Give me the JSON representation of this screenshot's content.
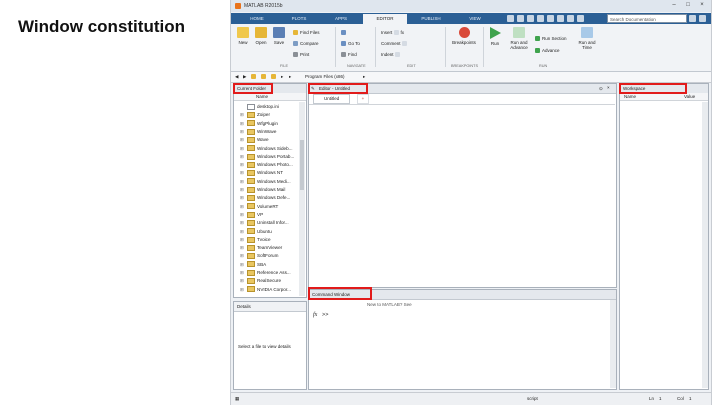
{
  "slide": {
    "title": "Window constitution"
  },
  "window": {
    "title": "MATLAB R2015b"
  },
  "toolstrip": {
    "tabs": [
      "HOME",
      "PLOTS",
      "APPS",
      "EDITOR",
      "PUBLISH",
      "VIEW"
    ],
    "active_tab": "EDITOR",
    "search_placeholder": "Search Documentation"
  },
  "ribbon": {
    "file": {
      "new": "New",
      "open": "Open",
      "save": "Save",
      "find_files": "Find Files",
      "compare": "Compare",
      "print": "Print",
      "group": "FILE"
    },
    "navigate": {
      "go_to": "Go To",
      "find": "Find",
      "group": "NAVIGATE"
    },
    "edit": {
      "insert": "Insert",
      "comment": "Comment",
      "indent": "Indent",
      "fx": "fx",
      "group": "EDIT"
    },
    "breakpoints": {
      "label": "Breakpoints",
      "group": "BREAKPOINTS"
    },
    "run": {
      "run": "Run",
      "run_and_advance": "Run and Advance",
      "run_section": "Run Section",
      "advance": "Advance",
      "run_and_time": "Run and Time",
      "group": "RUN"
    }
  },
  "address": {
    "path": "Program Files (x86)"
  },
  "current_folder": {
    "title": "Current Folder",
    "column": "Name",
    "files": [
      {
        "plus": "",
        "name": "desktop.ini",
        "folder": false
      },
      {
        "plus": "⊞",
        "name": "Zoiper",
        "folder": true
      },
      {
        "plus": "⊞",
        "name": "WfgPlugin",
        "folder": true
      },
      {
        "plus": "⊞",
        "name": "WinWave",
        "folder": true
      },
      {
        "plus": "⊞",
        "name": "Wave",
        "folder": true
      },
      {
        "plus": "⊞",
        "name": "Windows Sideb...",
        "folder": true
      },
      {
        "plus": "⊞",
        "name": "Windows Portab...",
        "folder": true
      },
      {
        "plus": "⊞",
        "name": "Windows Photo...",
        "folder": true
      },
      {
        "plus": "⊞",
        "name": "Windows NT",
        "folder": true
      },
      {
        "plus": "⊞",
        "name": "Windows Medi...",
        "folder": true
      },
      {
        "plus": "⊞",
        "name": "Windows Mail",
        "folder": true
      },
      {
        "plus": "⊞",
        "name": "Windows Defe...",
        "folder": true
      },
      {
        "plus": "⊞",
        "name": "VolumeRT",
        "folder": true
      },
      {
        "plus": "⊞",
        "name": "VP",
        "folder": true
      },
      {
        "plus": "⊞",
        "name": "Uninstall Infor...",
        "folder": true
      },
      {
        "plus": "⊞",
        "name": "Ubuntu",
        "folder": true
      },
      {
        "plus": "⊞",
        "name": "Tvoice",
        "folder": true
      },
      {
        "plus": "⊞",
        "name": "TeamViewer",
        "folder": true
      },
      {
        "plus": "⊞",
        "name": "SoftForum",
        "folder": true
      },
      {
        "plus": "⊞",
        "name": "SBA",
        "folder": true
      },
      {
        "plus": "⊞",
        "name": "Reference Ass...",
        "folder": true
      },
      {
        "plus": "⊞",
        "name": "RealSecure",
        "folder": true
      },
      {
        "plus": "⊞",
        "name": "NVIDIA Corpor...",
        "folder": true
      }
    ]
  },
  "details": {
    "title": "Details",
    "message": "Select a file to view details"
  },
  "editor": {
    "title": "Editor - Untitled",
    "tab": "Untitled",
    "add_tab": "+"
  },
  "command_window": {
    "title": "Command Window",
    "notice": "New to MATLAB? See",
    "prompt_symbol": "fx",
    "prompt": ">>"
  },
  "workspace": {
    "title": "Workspace",
    "col_name": "Name",
    "col_value": "Value"
  },
  "status": {
    "mode": "script",
    "ln_label": "Ln",
    "ln": "1",
    "col_label": "Col",
    "col": "1"
  }
}
